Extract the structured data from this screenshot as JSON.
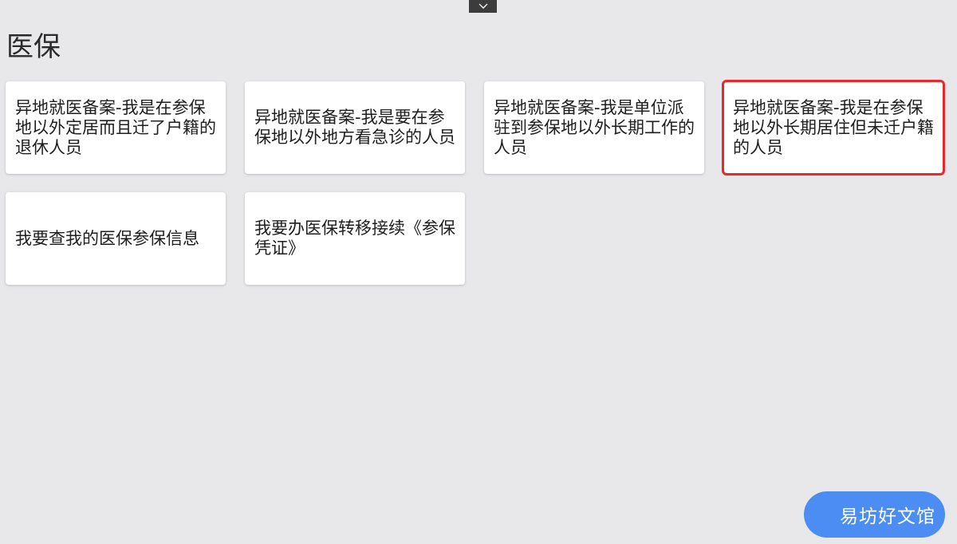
{
  "header": {
    "toggle_icon": "chevron-down-icon"
  },
  "section": {
    "title": "医保"
  },
  "cards": [
    {
      "label": "异地就医备案-我是在参保地以外定居而且迁了户籍的退休人员"
    },
    {
      "label": "异地就医备案-我是要在参保地以外地方看急诊的人员"
    },
    {
      "label": "异地就医备案-我是单位派驻到参保地以外长期工作的人员"
    },
    {
      "label": "异地就医备案-我是在参保地以外长期居住但未迁户籍的人员",
      "selected": true
    },
    {
      "label": "我要查我的医保参保信息"
    },
    {
      "label": "我要办医保转移接续《参保凭证》"
    }
  ],
  "watermark": {
    "text": "易坊好文馆"
  },
  "colors": {
    "background": "#e8e8ea",
    "selected_outline": "#e8282b",
    "watermark_bg": "#4b8df2"
  }
}
